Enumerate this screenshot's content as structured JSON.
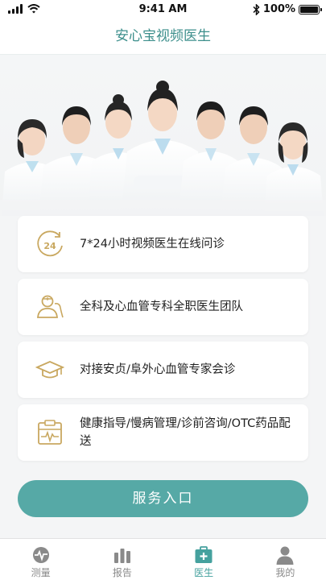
{
  "status_bar": {
    "time": "9:41 AM",
    "battery": "100%"
  },
  "header": {
    "title": "安心宝视频医生"
  },
  "features": [
    {
      "icon": "clock-24-icon",
      "text": "7*24小时视频医生在线问诊"
    },
    {
      "icon": "doctor-team-icon",
      "text": "全科及心血管专科全职医生团队"
    },
    {
      "icon": "graduation-cap-icon",
      "text": "对接安贞/阜外心血管专家会诊"
    },
    {
      "icon": "clipboard-ecg-icon",
      "text": "健康指导/慢病管理/诊前咨询/OTC药品配送"
    }
  ],
  "service_button": {
    "label": "服务入口"
  },
  "tabbar": {
    "tabs": [
      {
        "label": "测量",
        "icon": "heartbeat-icon",
        "active": false
      },
      {
        "label": "报告",
        "icon": "bar-chart-icon",
        "active": false
      },
      {
        "label": "医生",
        "icon": "medical-kit-icon",
        "active": true
      },
      {
        "label": "我的",
        "icon": "person-icon",
        "active": false
      }
    ]
  },
  "colors": {
    "accent": "#45a19e",
    "button": "#56a9a6",
    "icon_gold": "#c9a860",
    "title": "#3d8f8c"
  }
}
